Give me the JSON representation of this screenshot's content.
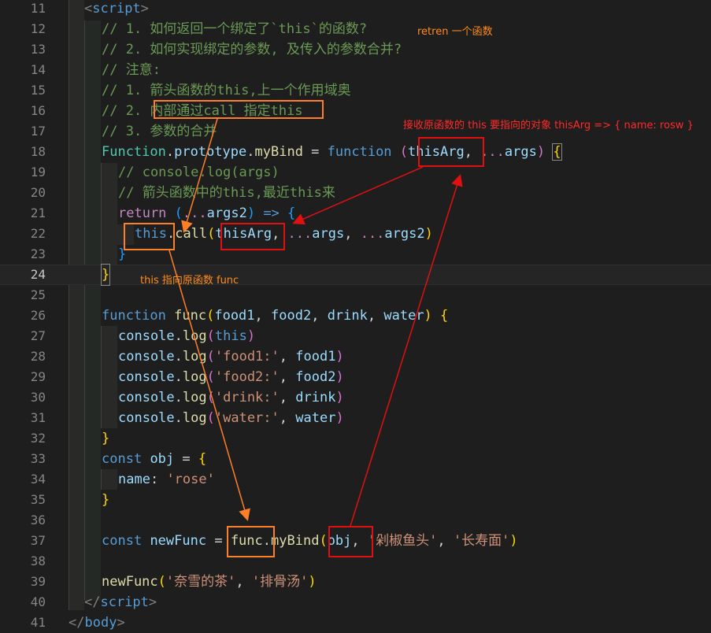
{
  "gutter": {
    "line_numbers": [
      "11",
      "12",
      "13",
      "14",
      "15",
      "16",
      "17",
      "18",
      "19",
      "20",
      "21",
      "22",
      "23",
      "24",
      "25",
      "26",
      "27",
      "28",
      "29",
      "30",
      "31",
      "32",
      "33",
      "34",
      "35",
      "36",
      "37",
      "38",
      "39",
      "40",
      "41"
    ],
    "current_line": "24"
  },
  "code": {
    "l11": {
      "open": "<",
      "name": "script",
      "close": ">"
    },
    "l12": "// 1. 如何返回一个绑定了`this`的函数?",
    "l13": "// 2. 如何实现绑定的参数, 及传入的参数合并?",
    "l14": "// 注意:",
    "l15": "// 1. 箭头函数的this,上一个作用域奥",
    "l16": {
      "a": "// 2. ",
      "b": "内部通过call 指定this"
    },
    "l17": "// 3. 参数的合并",
    "l18": {
      "cls": "Function",
      "dot1": ".",
      "proto": "prototype",
      "dot2": ".",
      "method": "myBind",
      "eq": " = ",
      "kw": "function",
      "sp": " ",
      "lp": "(",
      "param1": "thisArg",
      "comma": ", ",
      "spread": "...",
      "param2": "args",
      "rp": ")",
      "sp2": " ",
      "lb": "{"
    },
    "l19": "// console.log(args)",
    "l20": "// 箭头函数中的this,最近this来",
    "l21": {
      "ret": "return",
      "sp": " ",
      "lp": "(",
      "spread": "...",
      "param": "args2",
      "rp": ")",
      "arrow": " => ",
      "lb": "{"
    },
    "l22": {
      "this": "this",
      "dot": ".",
      "call": "call",
      "lp": "(",
      "a1": "thisArg",
      "c1": ", ",
      "s1": "...",
      "a2": "args",
      "c2": ", ",
      "s2": "...",
      "a3": "args2",
      "rp": ")"
    },
    "l23": "}",
    "l24": "}",
    "l26": {
      "kw": "function",
      "sp": " ",
      "name": "func",
      "lp": "(",
      "p1": "food1",
      "c1": ", ",
      "p2": "food2",
      "c2": ", ",
      "p3": "drink",
      "c3": ", ",
      "p4": "water",
      "rp": ")",
      "sp2": " ",
      "lb": "{"
    },
    "l27": {
      "obj": "console",
      "dot": ".",
      "fn": "log",
      "lp": "(",
      "arg": "this",
      "rp": ")"
    },
    "l28": {
      "obj": "console",
      "dot": ".",
      "fn": "log",
      "lp": "(",
      "str": "'food1:'",
      "c": ", ",
      "arg": "food1",
      "rp": ")"
    },
    "l29": {
      "obj": "console",
      "dot": ".",
      "fn": "log",
      "lp": "(",
      "str": "'food2:'",
      "c": ", ",
      "arg": "food2",
      "rp": ")"
    },
    "l30": {
      "obj": "console",
      "dot": ".",
      "fn": "log",
      "lp": "(",
      "str": "'drink:'",
      "c": ", ",
      "arg": "drink",
      "rp": ")"
    },
    "l31": {
      "obj": "console",
      "dot": ".",
      "fn": "log",
      "lp": "(",
      "str": "'water:'",
      "c": ", ",
      "arg": "water",
      "rp": ")"
    },
    "l32": "}",
    "l33": {
      "kw": "const",
      "sp": " ",
      "name": "obj",
      "eq": " = ",
      "lb": "{"
    },
    "l34": {
      "key": "name",
      "colon": ": ",
      "val": "'rose'"
    },
    "l35": "}",
    "l37": {
      "kw": "const",
      "sp": " ",
      "name": "newFunc",
      "eq": " = ",
      "obj": "func",
      "dot": ".",
      "method": "myBind",
      "lp": "(",
      "a1": "obj",
      "c1": ", ",
      "a2": "'剁椒鱼头'",
      "c2": ", ",
      "a3": "'长寿面'",
      "rp": ")"
    },
    "l39": {
      "fn": "newFunc",
      "lp": "(",
      "a1": "'奈雪的茶'",
      "c1": ", ",
      "a2": "'排骨汤'",
      "rp": ")"
    },
    "l40": {
      "open": "</",
      "name": "script",
      "close": ">"
    },
    "l41": {
      "open": "</",
      "name": "body",
      "close": ">"
    }
  },
  "annotations": {
    "note1": "retren 一个函数",
    "note2": "接收原函数的 this 要指向的对象 thisArg => { name: rosw }",
    "note3": "this 指向原函数 func"
  },
  "colors": {
    "background": "#1e1e1e",
    "orange_annotation": "#ff7f27",
    "red_annotation": "#e01010",
    "keyword": "#569cd6",
    "control": "#c586c0",
    "function": "#dcdcaa",
    "variable": "#9cdcfe",
    "string": "#ce9178",
    "comment": "#6a9955",
    "class": "#4ec9b0"
  }
}
